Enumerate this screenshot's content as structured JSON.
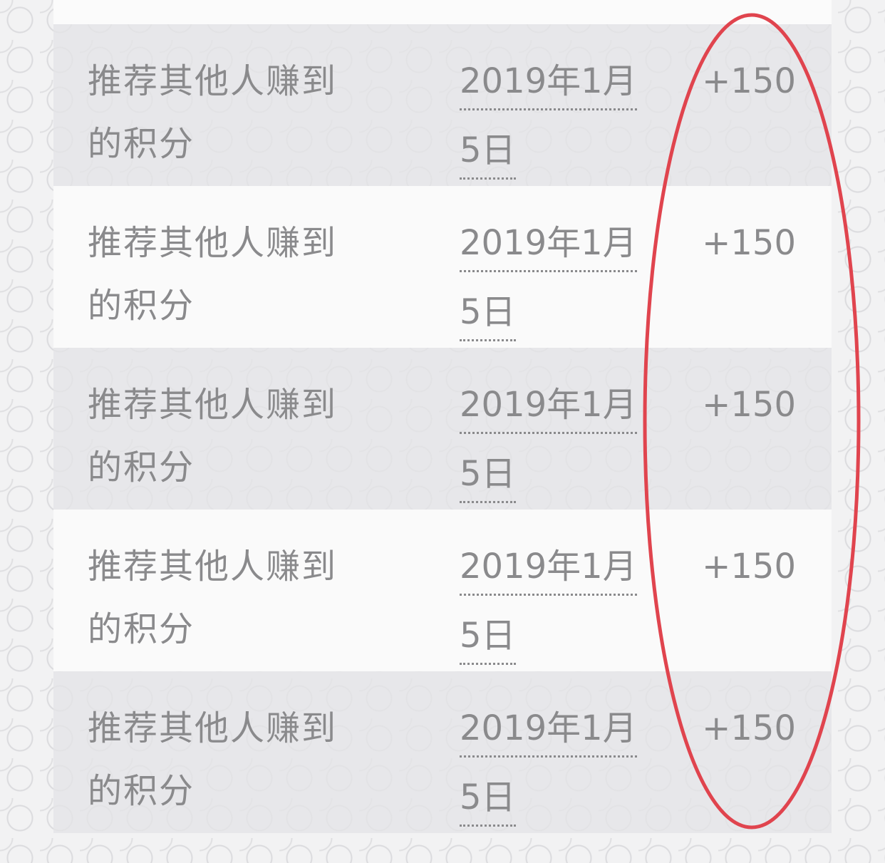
{
  "rows": [
    {
      "desc_line1": "推荐其他人赚到",
      "desc_line2": "的积分",
      "date_line1": "2019年1月",
      "date_line2": "5日",
      "points": "+150"
    },
    {
      "desc_line1": "推荐其他人赚到",
      "desc_line2": "的积分",
      "date_line1": "2019年1月",
      "date_line2": "5日",
      "points": "+150"
    },
    {
      "desc_line1": "推荐其他人赚到",
      "desc_line2": "的积分",
      "date_line1": "2019年1月",
      "date_line2": "5日",
      "points": "+150"
    },
    {
      "desc_line1": "推荐其他人赚到",
      "desc_line2": "的积分",
      "date_line1": "2019年1月",
      "date_line2": "5日",
      "points": "+150"
    },
    {
      "desc_line1": "推荐其他人赚到",
      "desc_line2": "的积分",
      "date_line1": "2019年1月",
      "date_line2": "5日",
      "points": "+150"
    }
  ],
  "colors": {
    "text": "#8a8a8c",
    "shaded_row": "#e6e6e9",
    "plain_row": "#fafafa",
    "highlight": "#e0444e"
  }
}
